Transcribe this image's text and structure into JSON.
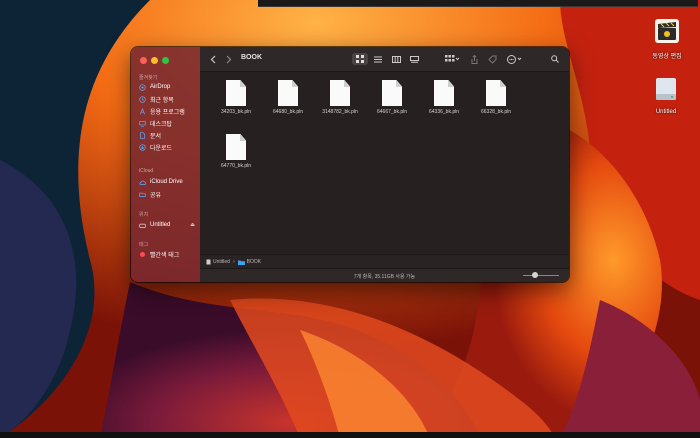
{
  "menu_bar": {},
  "desktop": {
    "icons": [
      {
        "label": "동영상 편집",
        "icon": "clapperboard-icon"
      },
      {
        "label": "Untitled",
        "icon": "drive-icon"
      }
    ]
  },
  "finder": {
    "title": "BOOK",
    "sidebar": {
      "sections": [
        {
          "label": "즐겨찾기",
          "items": [
            {
              "label": "AirDrop",
              "icon": "airdrop-icon"
            },
            {
              "label": "최근 항목",
              "icon": "clock-icon"
            },
            {
              "label": "응용 프로그램",
              "icon": "apps-icon"
            },
            {
              "label": "데스크탑",
              "icon": "desktop-icon"
            },
            {
              "label": "문서",
              "icon": "document-icon"
            },
            {
              "label": "다운로드",
              "icon": "download-icon"
            }
          ]
        },
        {
          "label": "iCloud",
          "items": [
            {
              "label": "iCloud Drive",
              "icon": "cloud-icon"
            },
            {
              "label": "공유",
              "icon": "shared-folder-icon"
            }
          ]
        },
        {
          "label": "위치",
          "items": [
            {
              "label": "Untitled",
              "icon": "drive-icon",
              "eject": "⏏"
            }
          ]
        },
        {
          "label": "태그",
          "items": [
            {
              "label": "빨간색 태그",
              "icon": "red-tag-icon"
            }
          ]
        }
      ]
    },
    "files": [
      "34203_bk.pln",
      "64680_bk.pln",
      "3148782_bk.pln",
      "64667_bk.pln",
      "64336_bk.pln",
      "66328_bk.pln",
      "64770_bk.pln"
    ],
    "path": {
      "drive": "Untitled",
      "separator": "›",
      "folder": "BOOK"
    },
    "status": "7개 항목, 35.11GB 사용 가능",
    "colors": {
      "sidebar": "#782830",
      "content": "#262120",
      "folder_blue": "#3fa2ee",
      "tag_red": "#ff4b4b"
    }
  }
}
